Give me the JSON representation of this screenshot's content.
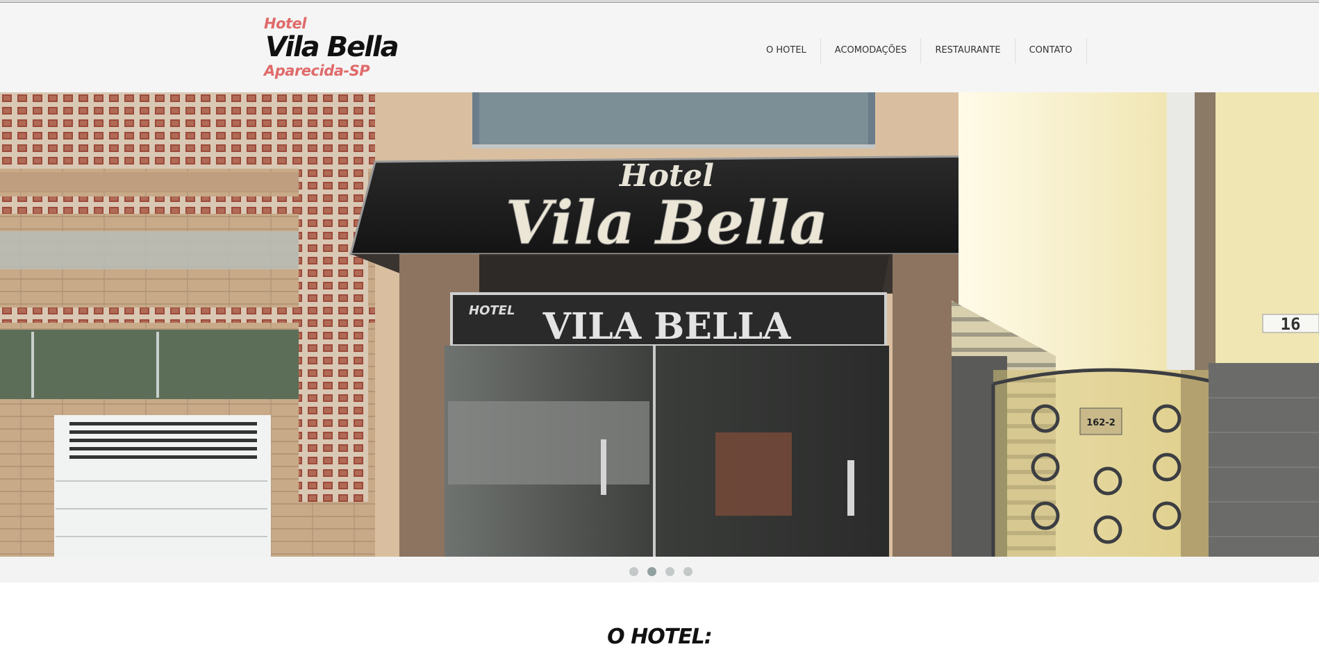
{
  "logo": {
    "line1": "Hotel",
    "line2": "Vila Bella",
    "line3": "Aparecida-SP"
  },
  "nav": {
    "items": [
      {
        "label": "O HOTEL"
      },
      {
        "label": "ACOMODAÇÕES"
      },
      {
        "label": "RESTAURANTE"
      },
      {
        "label": "CONTATO"
      }
    ]
  },
  "hero": {
    "sign_hotel": "Hotel",
    "sign_name": "Vila Bella",
    "sign2_hotel": "HOTEL",
    "sign2_name": "VILA BELLA",
    "street_number": "16",
    "gate_number": "162-2"
  },
  "slider": {
    "count": 4,
    "active_index": 1
  },
  "section": {
    "title": "O HOTEL:"
  },
  "colors": {
    "accent": "#e06a6a",
    "header_bg": "#f5f5f5",
    "dot_active": "#8fa09f",
    "dot_inactive": "#c4c8c8"
  }
}
